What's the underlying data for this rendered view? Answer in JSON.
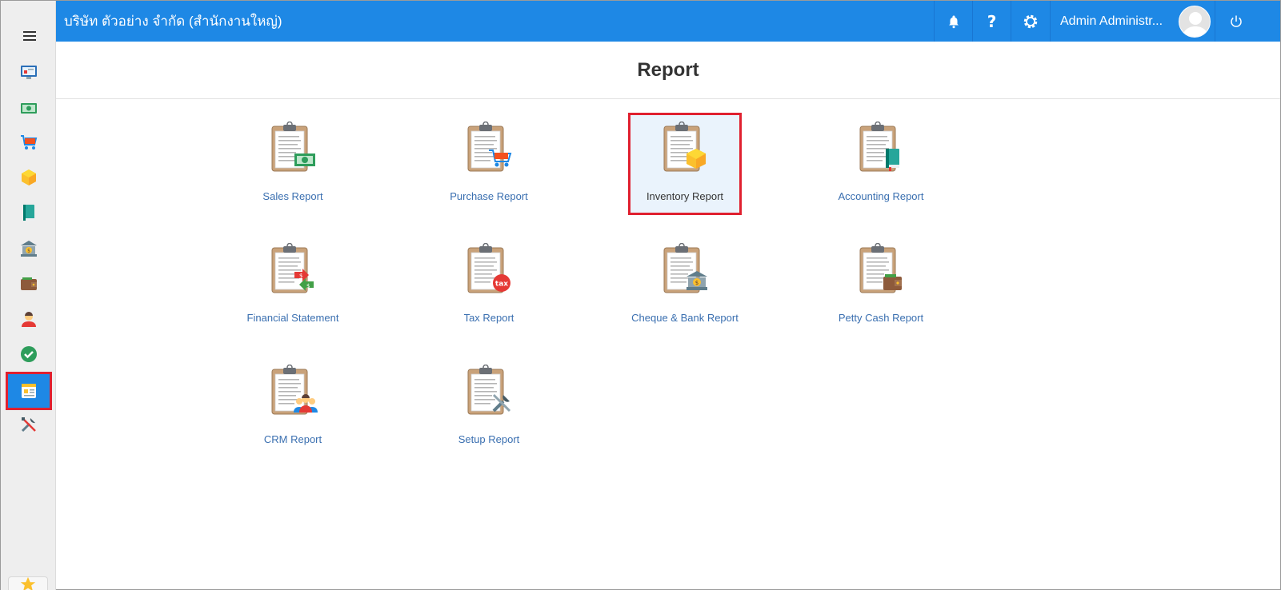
{
  "header": {
    "company": "บริษัท ตัวอย่าง จำกัด (สำนักงานใหญ่)",
    "user_name": "Admin Administr..."
  },
  "page": {
    "title": "Report"
  },
  "sidebar": {
    "items": [
      {
        "icon": "dashboard-icon"
      },
      {
        "icon": "money-icon"
      },
      {
        "icon": "cart-icon"
      },
      {
        "icon": "box-icon"
      },
      {
        "icon": "book-icon"
      },
      {
        "icon": "bank-icon"
      },
      {
        "icon": "wallet-icon"
      },
      {
        "icon": "contacts-icon"
      },
      {
        "icon": "check-icon"
      },
      {
        "icon": "report-icon",
        "active": true
      },
      {
        "icon": "tools-icon"
      }
    ]
  },
  "reports": {
    "sales": "Sales Report",
    "purchase": "Purchase Report",
    "inventory": "Inventory Report",
    "accounting": "Accounting Report",
    "financial": "Financial Statement",
    "tax": "Tax Report",
    "cheque": "Cheque & Bank Report",
    "petty": "Petty Cash Report",
    "crm": "CRM Report",
    "setup": "Setup Report"
  },
  "colors": {
    "header_bg": "#1e88e5",
    "highlight": "#e0202f",
    "link": "#3a6fb0"
  }
}
